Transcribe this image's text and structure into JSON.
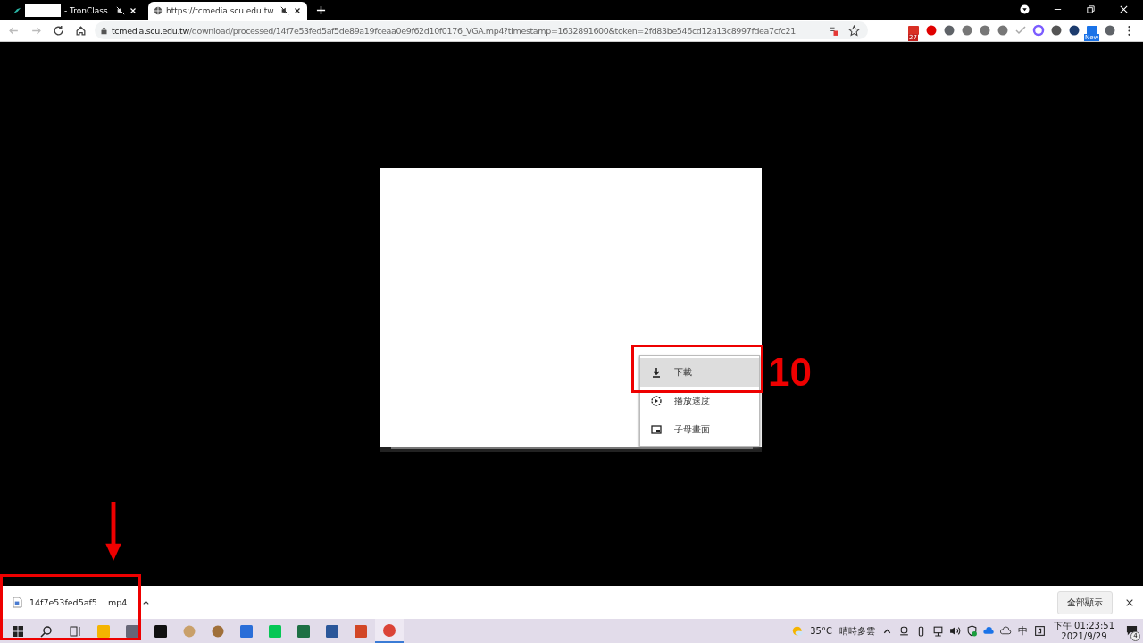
{
  "browser": {
    "tabs": [
      {
        "title": "- TronClass",
        "selected": false,
        "muted": true,
        "redacted": true
      },
      {
        "title": "https://tcmedia.scu.edu.tw",
        "selected": true,
        "muted": true,
        "redacted": false
      }
    ],
    "address": {
      "host": "tcmedia.scu.edu.tw",
      "path": "/download/processed/14f7e53fed5af5de89a19fceaa0e9f62d10f0176_VGA.mp4?timestamp=1632891600&token=2fd83be546cd12a13c8997fdea7cfc21"
    },
    "extensions": [
      {
        "kind": "mail",
        "badge": "27"
      },
      {
        "kind": "stop"
      },
      {
        "kind": "script"
      },
      {
        "kind": "camera"
      },
      {
        "kind": "external"
      },
      {
        "kind": "expand"
      },
      {
        "kind": "check"
      },
      {
        "kind": "ring"
      },
      {
        "kind": "bulb"
      },
      {
        "kind": "coin"
      },
      {
        "kind": "window",
        "badge": "New"
      },
      {
        "kind": "puzzle"
      }
    ]
  },
  "video_menu": [
    {
      "kind": "download",
      "label": "下載",
      "selected": true
    },
    {
      "kind": "speed",
      "label": "播放速度",
      "selected": false
    },
    {
      "kind": "pip",
      "label": "子母畫面",
      "selected": false
    }
  ],
  "annotation": {
    "step": "10"
  },
  "download_bar": {
    "file": "14f7e53fed5af5....mp4",
    "show_all": "全部顯示"
  },
  "taskbar": {
    "apps": [
      {
        "kind": "start",
        "selected": false
      },
      {
        "kind": "search",
        "selected": false
      },
      {
        "kind": "taskview",
        "selected": false
      },
      {
        "kind": "folder",
        "selected": false
      },
      {
        "kind": "calculator",
        "selected": false
      },
      {
        "kind": "scissors",
        "selected": false
      },
      {
        "kind": "palette",
        "selected": false
      },
      {
        "kind": "bird",
        "selected": false
      },
      {
        "kind": "photos",
        "selected": false
      },
      {
        "kind": "chat",
        "selected": false
      },
      {
        "kind": "excel",
        "selected": false
      },
      {
        "kind": "word",
        "selected": false
      },
      {
        "kind": "powerpoint",
        "selected": false
      },
      {
        "kind": "chrome",
        "selected": true
      }
    ],
    "weather": {
      "temp": "35°C",
      "text": "晴時多雲"
    },
    "ime": "中",
    "time": "下午 01:23:51",
    "date": "2021/9/29",
    "notifications": "4"
  }
}
